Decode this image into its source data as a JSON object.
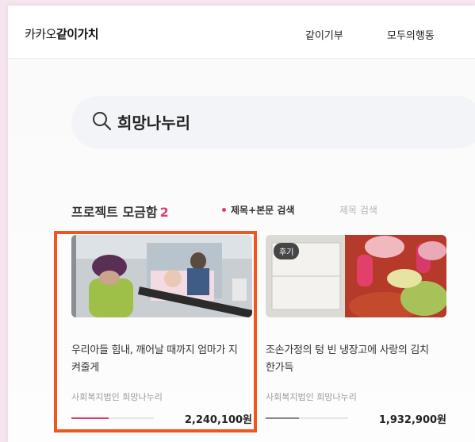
{
  "header": {
    "logo_prefix": "카카오",
    "logo_brand": "같이가치",
    "nav": [
      "같이기부",
      "모두의행동"
    ]
  },
  "search": {
    "value": "희망나누리",
    "icon": "search-icon"
  },
  "section": {
    "title": "프로젝트 모금함",
    "count": "2",
    "filter_active": "제목+본문 검색",
    "filter_inactive": "제목 검색"
  },
  "cards": [
    {
      "title_line1": "우리아들 힘내, 깨어날 때까지 엄마가 지",
      "title_line2": "켜줄게",
      "org": "사회복지법인 희망나누리",
      "amount": "2,240,100원",
      "progress": 0.45,
      "image": "mother visiting son in hospital bed"
    },
    {
      "badge": "후기",
      "title_line1": "조손가정의 텅 빈 냉장고에 사랑의 김치",
      "title_line2": "한가득",
      "org": "사회복지법인 희망나누리",
      "amount": "1,932,900원",
      "progress": 0.4,
      "image": "volunteers making kimchi"
    }
  ],
  "colors": {
    "accent": "#e03a7a",
    "highlight_border": "#f0561d",
    "background": "#f6e4ee"
  }
}
